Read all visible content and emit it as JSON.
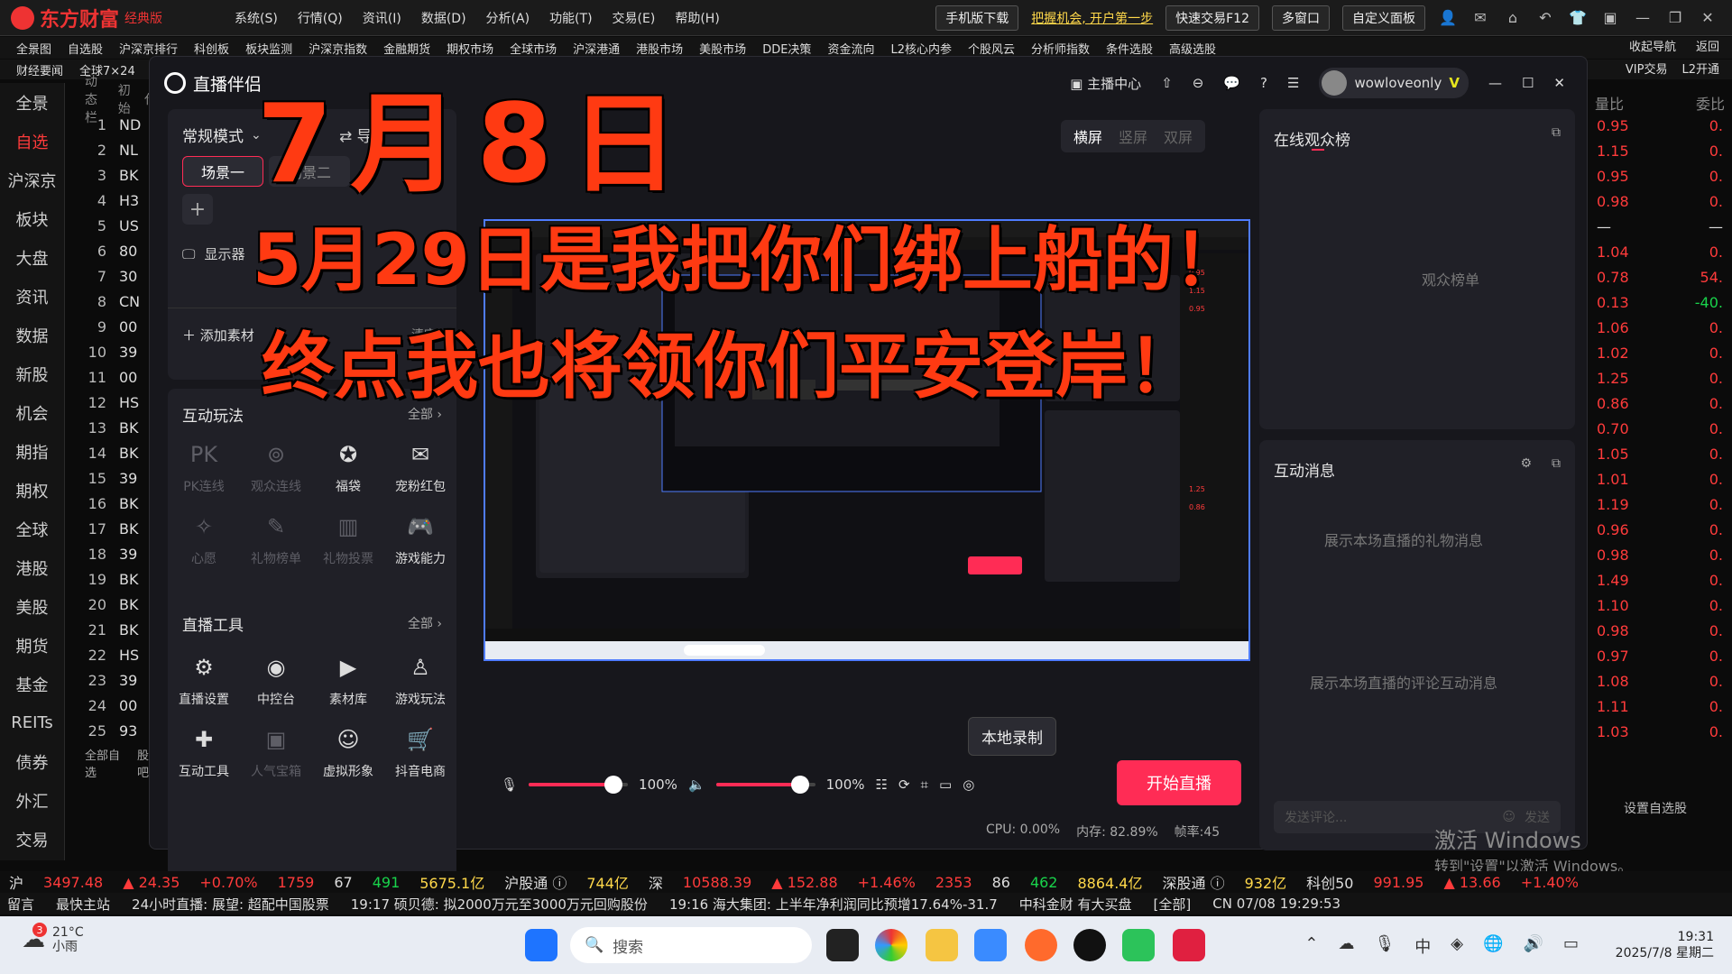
{
  "topbar": {
    "brand": "东方财富",
    "brand_sub": "经典版",
    "menu": [
      "系统(S)",
      "行情(Q)",
      "资讯(I)",
      "数据(D)",
      "分析(A)",
      "功能(T)",
      "交易(E)",
      "帮助(H)"
    ],
    "mobile_download": "手机版下载",
    "promo": "把握机会, 开户第一步",
    "quick_trade": "快速交易F12",
    "multi_window": "多窗口",
    "custom_panel": "自定义面板"
  },
  "navbar": {
    "row1": [
      "全景图",
      "自选股",
      "沪深京排行",
      "科创板",
      "板块监测",
      "沪深京指数",
      "金融期货",
      "期权市场",
      "全球市场",
      "沪深港通",
      "港股市场",
      "美股市场",
      "DDE决策",
      "资金流向",
      "L2核心内参",
      "个股风云",
      "分析师指数",
      "条件选股",
      "高级选股"
    ],
    "row1_right": [
      "收起导航",
      "返回"
    ],
    "row2": [
      "财经要闻",
      "全球7×24"
    ],
    "row2_right": [
      "VIP交易",
      "L2开通"
    ]
  },
  "sidebar": [
    "全景",
    "自选",
    "沪深京",
    "板块",
    "大盘",
    "资讯",
    "数据",
    "新股",
    "机会",
    "期指",
    "期权",
    "全球",
    "港股",
    "美股",
    "期货",
    "基金",
    "REITs",
    "债券",
    "外汇",
    "交易"
  ],
  "sidebar_active": "自选",
  "stocklist": {
    "tabs": [
      "动态栏",
      "初始",
      "代"
    ],
    "rows": [
      [
        "1",
        "ND"
      ],
      [
        "2",
        "NL"
      ],
      [
        "3",
        "BK"
      ],
      [
        "4",
        "H3"
      ],
      [
        "5",
        "US"
      ],
      [
        "6",
        "80"
      ],
      [
        "7",
        "30"
      ],
      [
        "8",
        "CN"
      ],
      [
        "9",
        "00"
      ],
      [
        "10",
        "39"
      ],
      [
        "11",
        "00"
      ],
      [
        "12",
        "HS"
      ],
      [
        "13",
        "BK"
      ],
      [
        "14",
        "BK"
      ],
      [
        "15",
        "39"
      ],
      [
        "16",
        "BK"
      ],
      [
        "17",
        "BK"
      ],
      [
        "18",
        "39"
      ],
      [
        "19",
        "BK"
      ],
      [
        "20",
        "BK"
      ],
      [
        "21",
        "BK"
      ],
      [
        "22",
        "HS"
      ],
      [
        "23",
        "39"
      ],
      [
        "24",
        "00"
      ],
      [
        "25",
        "93"
      ]
    ],
    "footer": [
      "全部自选",
      "股吧"
    ]
  },
  "rightcols": {
    "headers": [
      "量比",
      "委比"
    ],
    "rows": [
      [
        "0.95",
        "0."
      ],
      [
        "1.15",
        "0."
      ],
      [
        "0.95",
        "0."
      ],
      [
        "0.98",
        "0."
      ],
      [
        "—",
        "—"
      ],
      [
        "1.04",
        "0."
      ],
      [
        "0.78",
        "54."
      ],
      [
        "0.13",
        "-40."
      ],
      [
        "1.06",
        "0."
      ],
      [
        "1.02",
        "0."
      ],
      [
        "1.25",
        "0."
      ],
      [
        "0.86",
        "0."
      ],
      [
        "0.70",
        "0."
      ],
      [
        "1.05",
        "0."
      ],
      [
        "1.01",
        "0."
      ],
      [
        "1.19",
        "0."
      ],
      [
        "0.96",
        "0."
      ],
      [
        "0.98",
        "0."
      ],
      [
        "1.49",
        "0."
      ],
      [
        "1.10",
        "0."
      ],
      [
        "0.98",
        "0."
      ],
      [
        "0.97",
        "0."
      ],
      [
        "1.08",
        "0."
      ],
      [
        "1.11",
        "0."
      ],
      [
        "1.03",
        "0."
      ]
    ],
    "set_button": "设置自选股"
  },
  "app": {
    "name": "直播伴侣",
    "host_center": "主播中心",
    "username": "wowloveonly",
    "mode": "常规模式",
    "import": "导",
    "scenes": [
      "场景一",
      "场景二"
    ],
    "add": "+",
    "display_capture": "显示器",
    "add_material": "添加素材",
    "clear": "清空",
    "layout_tabs": [
      "横屏",
      "竖屏",
      "双屏"
    ],
    "interact_title": "互动玩法",
    "all": "全部",
    "interact_items": [
      {
        "label": "PK连线",
        "icon": "pk-icon",
        "on": false
      },
      {
        "label": "观众连线",
        "icon": "audience-link-icon",
        "on": false
      },
      {
        "label": "福袋",
        "icon": "lucky-bag-icon",
        "on": true
      },
      {
        "label": "宠粉红包",
        "icon": "red-packet-icon",
        "on": true
      },
      {
        "label": "心愿",
        "icon": "wish-icon",
        "on": false
      },
      {
        "label": "礼物榜单",
        "icon": "gift-rank-icon",
        "on": false
      },
      {
        "label": "礼物投票",
        "icon": "gift-vote-icon",
        "on": false
      },
      {
        "label": "游戏能力",
        "icon": "gamepad-icon",
        "on": true
      }
    ],
    "tools_title": "直播工具",
    "tool_items": [
      {
        "label": "直播设置",
        "icon": "settings-icon",
        "on": true
      },
      {
        "label": "中控台",
        "icon": "console-icon",
        "on": true
      },
      {
        "label": "素材库",
        "icon": "library-icon",
        "on": true
      },
      {
        "label": "游戏玩法",
        "icon": "game-play-icon",
        "on": true
      },
      {
        "label": "互动工具",
        "icon": "puzzle-icon",
        "on": true
      },
      {
        "label": "人气宝箱",
        "icon": "treasure-icon",
        "on": false
      },
      {
        "label": "虚拟形象",
        "icon": "avatar-icon",
        "on": true
      },
      {
        "label": "抖音电商",
        "icon": "cart-icon",
        "on": true
      }
    ],
    "viewers_title": "在线观众榜",
    "viewers_empty": "观众榜单",
    "msg_title": "互动消息",
    "gift_hint": "展示本场直播的礼物消息",
    "comment_hint": "展示本场直播的评论互动消息",
    "msg_placeholder": "发送评论...",
    "send": "发送",
    "mic_volume": "100%",
    "speaker_volume": "100%",
    "mic_level": 0.85,
    "speaker_level": 0.85,
    "tooltip": "本地录制",
    "start": "开始直播",
    "cpu": "CPU: 0.00%",
    "mem": "内存: 82.89%",
    "fps": "帧率:45"
  },
  "overlay": {
    "date": "7月8日",
    "line1": "5月29日是我把你们绑上船的！",
    "line2": "终点我也将领你们平安登岸！"
  },
  "watermark": {
    "title": "激活 Windows",
    "sub": "转到\"设置\"以激活 Windows。"
  },
  "ticker": [
    {
      "t": "沪",
      "c": "wh"
    },
    {
      "t": "3497.48",
      "c": "up"
    },
    {
      "t": "▲ 24.35",
      "c": "up"
    },
    {
      "t": "+0.70%",
      "c": "up"
    },
    {
      "t": "1759",
      "c": "up"
    },
    {
      "t": "67",
      "c": "wh"
    },
    {
      "t": "491",
      "c": "dn"
    },
    {
      "t": "5675.1亿",
      "c": "yl"
    },
    {
      "t": "沪股通 ⓘ",
      "c": "wh"
    },
    {
      "t": "744亿",
      "c": "yl"
    },
    {
      "t": "深",
      "c": "wh"
    },
    {
      "t": "10588.39",
      "c": "up"
    },
    {
      "t": "▲ 152.88",
      "c": "up"
    },
    {
      "t": "+1.46%",
      "c": "up"
    },
    {
      "t": "2353",
      "c": "up"
    },
    {
      "t": "86",
      "c": "wh"
    },
    {
      "t": "462",
      "c": "dn"
    },
    {
      "t": "8864.4亿",
      "c": "yl"
    },
    {
      "t": "深股通 ⓘ",
      "c": "wh"
    },
    {
      "t": "932亿",
      "c": "yl"
    },
    {
      "t": "科创50",
      "c": "wh"
    },
    {
      "t": "991.95",
      "c": "up"
    },
    {
      "t": "▲ 13.66",
      "c": "up"
    },
    {
      "t": "+1.40%",
      "c": "up"
    }
  ],
  "news": [
    "留言",
    "最快主站",
    "24小时直播: 展望: 超配中国股票",
    "19:17 硕贝德: 拟2000万元至3000万元回购股份",
    "19:16 海大集团: 上半年净利润同比预增17.64%-31.7",
    "中科金财 有大买盘",
    "[全部]",
    "CN 07/08 19:29:53"
  ],
  "taskbar": {
    "temp": "21°C",
    "weather": "小雨",
    "notif": "3",
    "search": "搜索",
    "time": "19:31",
    "date": "2025/7/8 星期二"
  }
}
